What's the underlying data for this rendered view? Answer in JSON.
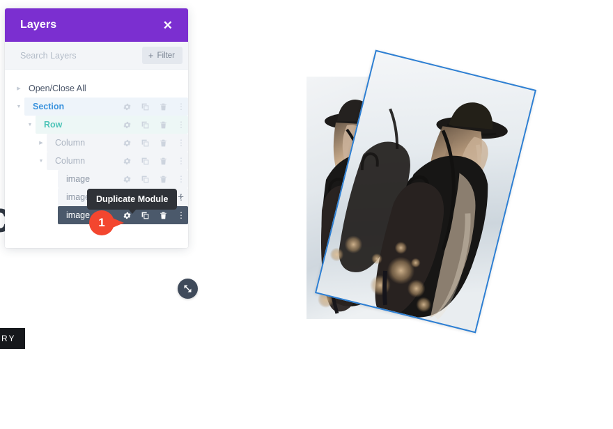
{
  "background": {
    "bleed_text": "ce",
    "bottom_tag": "RY"
  },
  "panel": {
    "title": "Layers",
    "close_icon": "close-icon",
    "search": {
      "placeholder": "Search Layers",
      "value": ""
    },
    "filter_button": {
      "label": "Filter",
      "plus": "+"
    },
    "open_close_all": "Open/Close All",
    "tree": [
      {
        "label": "Section",
        "type": "section",
        "indent": 0,
        "caret": "open",
        "selected": false,
        "icons": [
          "gear-icon",
          "duplicate-icon",
          "trash-icon",
          "more-options-icon"
        ]
      },
      {
        "label": "Row",
        "type": "row",
        "indent": 1,
        "caret": "open",
        "selected": false,
        "icons": [
          "gear-icon",
          "duplicate-icon",
          "trash-icon",
          "more-options-icon"
        ]
      },
      {
        "label": "Column",
        "type": "column",
        "indent": 2,
        "caret": "closed",
        "selected": false,
        "icons": [
          "gear-icon",
          "duplicate-icon",
          "trash-icon",
          "more-options-icon"
        ]
      },
      {
        "label": "Column",
        "type": "column",
        "indent": 2,
        "caret": "open",
        "selected": false,
        "icons": [
          "gear-icon",
          "duplicate-icon",
          "trash-icon",
          "more-options-icon"
        ]
      },
      {
        "label": "image",
        "type": "module",
        "indent": 3,
        "caret": "blank",
        "selected": false,
        "icons": [
          "gear-icon",
          "duplicate-icon",
          "trash-icon",
          "more-options-icon"
        ]
      },
      {
        "label": "image",
        "type": "module",
        "indent": 3,
        "caret": "blank",
        "selected": false,
        "hovered": true,
        "add_label": "+",
        "icons": [
          "gear-icon",
          "duplicate-icon",
          "trash-icon",
          "more-options-icon"
        ]
      },
      {
        "label": "image",
        "type": "module",
        "indent": 3,
        "caret": "blank",
        "selected": true,
        "icons": [
          "gear-icon",
          "duplicate-icon",
          "trash-icon",
          "more-options-icon"
        ]
      }
    ],
    "resize_handle_icon": "resize-diagonal-icon"
  },
  "tooltip": {
    "text": "Duplicate Module"
  },
  "step_badge": {
    "number": "1"
  },
  "colors": {
    "panel_header": "#7b2fd0",
    "section_label": "#3b93dd",
    "row_label": "#4fc4b8",
    "selected_row_bg": "#4b596b",
    "badge": "#f3462f",
    "tooltip_bg": "#2f3238",
    "image_border": "#2d7fd3"
  },
  "images": [
    {
      "name": "image-module-back",
      "alt": "Woman wearing hat with backpack"
    },
    {
      "name": "image-module-front",
      "alt": "Woman wearing hat with backpack",
      "selected": true,
      "rotation": "14deg"
    }
  ]
}
